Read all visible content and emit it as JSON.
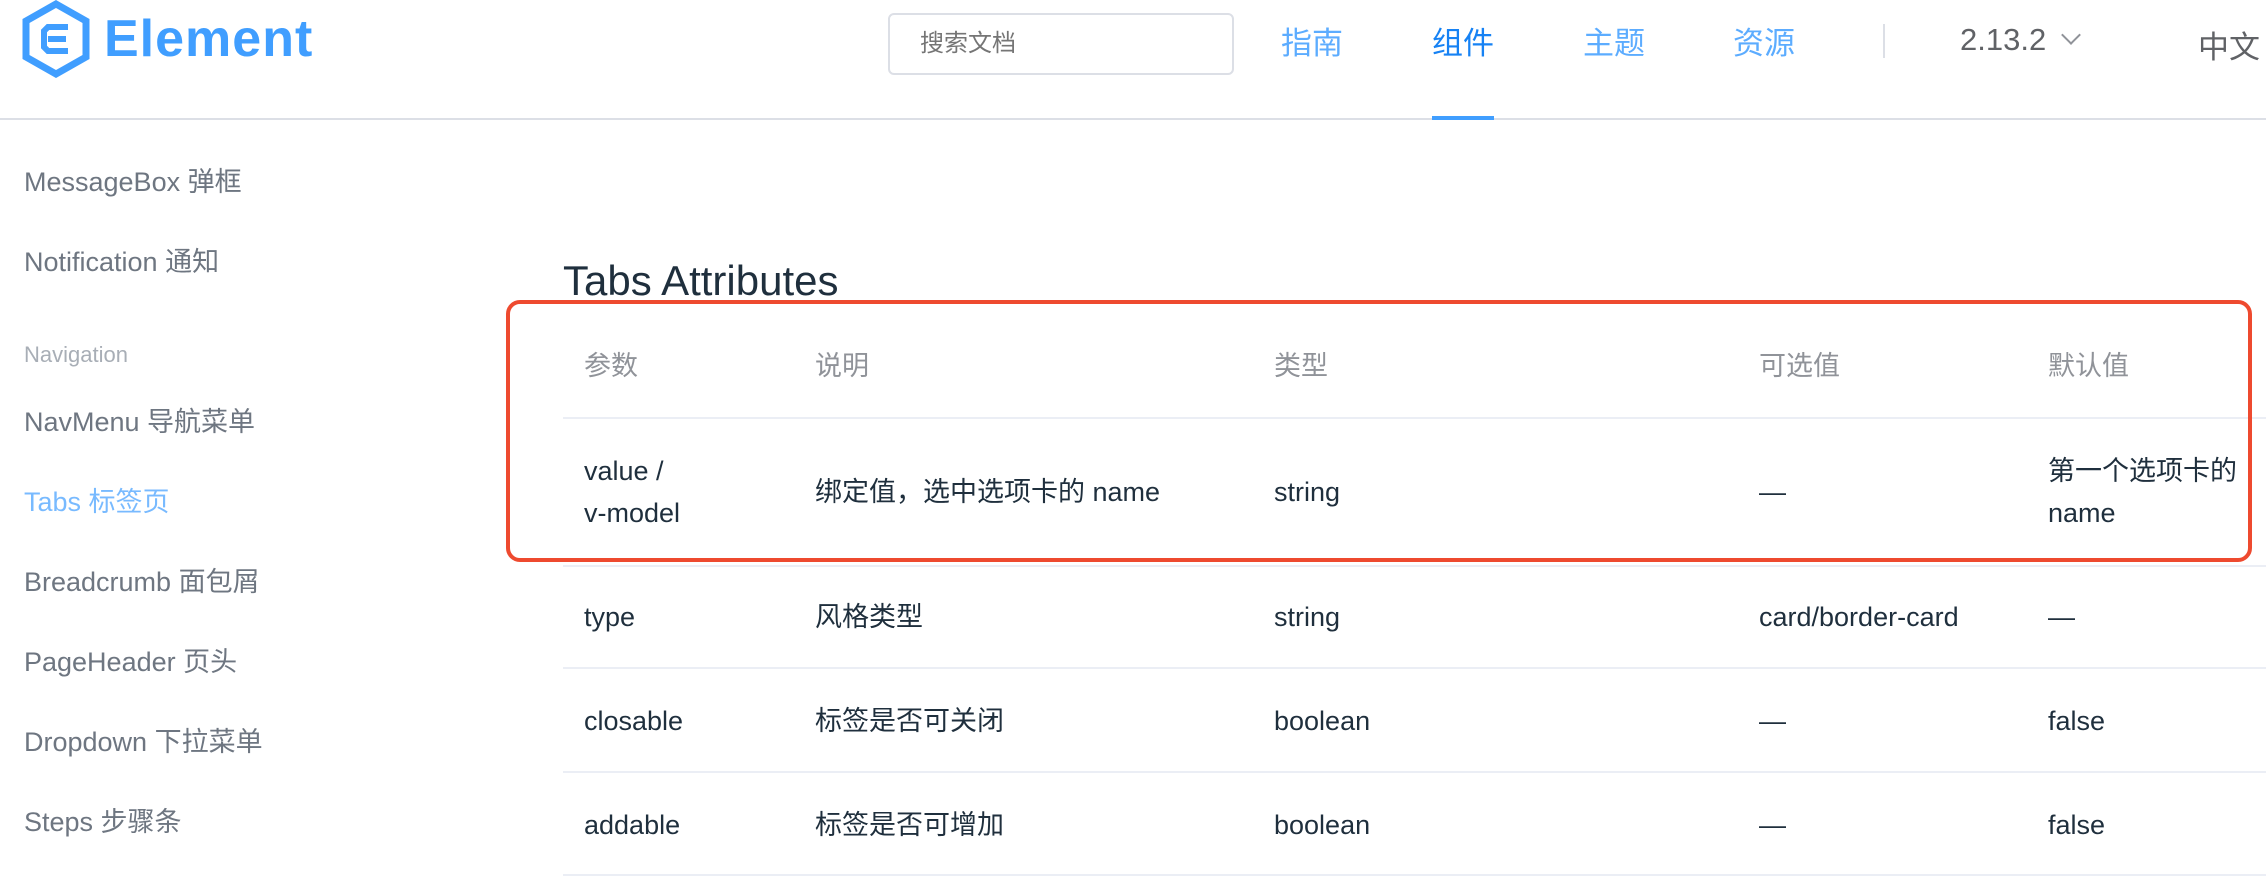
{
  "header": {
    "logo_text": "Element",
    "search_placeholder": "搜索文档",
    "nav": [
      "指南",
      "组件",
      "主题",
      "资源"
    ],
    "active_nav": "组件",
    "version": "2.13.2",
    "language": "中文"
  },
  "sidebar": {
    "items_top": [
      "MessageBox 弹框",
      "Notification 通知"
    ],
    "group_title": "Navigation",
    "items": [
      "NavMenu 导航菜单",
      "Tabs 标签页",
      "Breadcrumb 面包屑",
      "PageHeader 页头",
      "Dropdown 下拉菜单",
      "Steps 步骤条"
    ],
    "active_item": "Tabs 标签页"
  },
  "main": {
    "title": "Tabs Attributes",
    "table": {
      "headers": [
        "参数",
        "说明",
        "类型",
        "可选值",
        "默认值"
      ],
      "rows": [
        {
          "param_1": "value /",
          "param_2": "v-model",
          "desc": "绑定值，选中选项卡的 name",
          "type": "string",
          "options": "—",
          "default_1": "第一个选项卡的",
          "default_2": "name"
        },
        {
          "param": "type",
          "desc": "风格类型",
          "type": "string",
          "options": "card/border-card",
          "default": "—"
        },
        {
          "param": "closable",
          "desc": "标签是否可关闭",
          "type": "boolean",
          "options": "—",
          "default": "false"
        },
        {
          "param": "addable",
          "desc": "标签是否可增加",
          "type": "boolean",
          "options": "—",
          "default": "false"
        }
      ]
    }
  },
  "colors": {
    "accent": "#409eff",
    "highlight_border": "#ee4a2f"
  }
}
